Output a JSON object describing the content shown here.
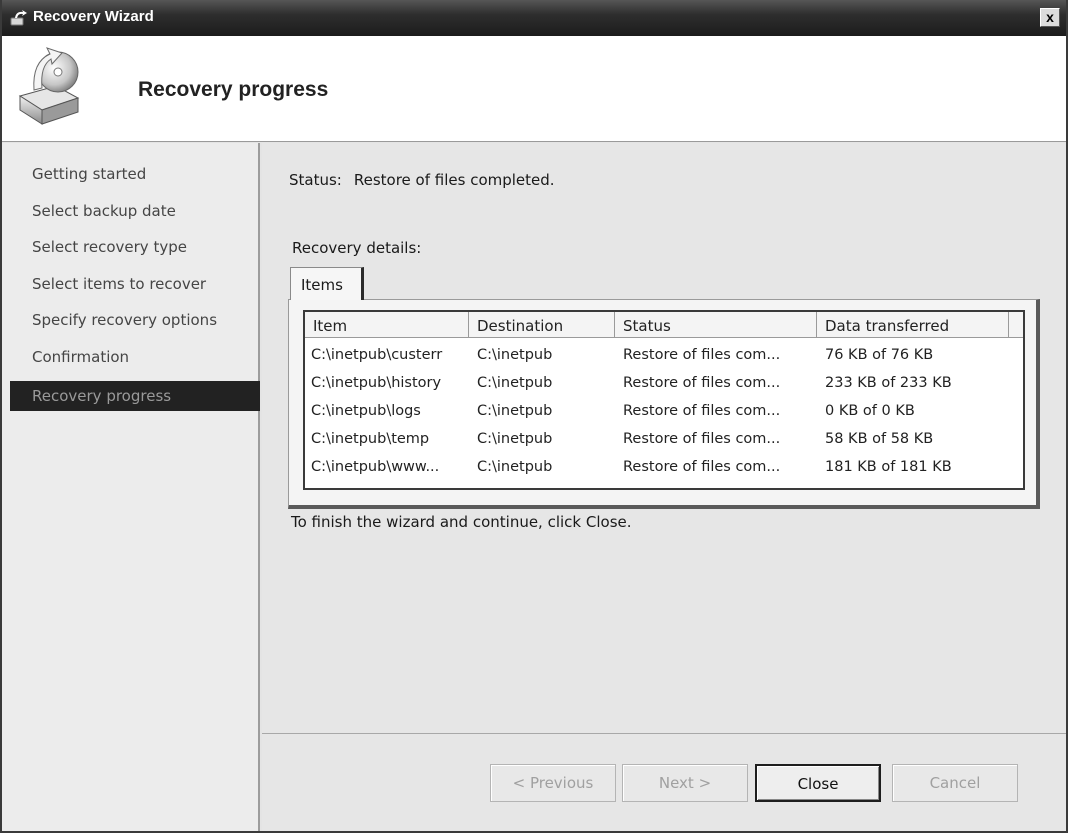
{
  "window": {
    "title": "Recovery Wizard",
    "close_glyph": "x",
    "header_title": "Recovery progress",
    "title_icon": "recovery-wizard-icon",
    "header_icon": "backup-drive-icon"
  },
  "nav": {
    "items": [
      {
        "label": "Getting started"
      },
      {
        "label": "Select backup date"
      },
      {
        "label": "Select recovery type"
      },
      {
        "label": "Select items to recover"
      },
      {
        "label": "Specify recovery options"
      },
      {
        "label": "Confirmation"
      },
      {
        "label": "Recovery progress"
      }
    ],
    "active_index": 6
  },
  "main": {
    "status_label": "Status:",
    "status_value": "Restore of files completed.",
    "details_label": "Recovery details:",
    "tab_label": "Items",
    "finish_text": "To finish the wizard and continue, click Close."
  },
  "table": {
    "columns": [
      "Item",
      "Destination",
      "Status",
      "Data transferred"
    ],
    "rows": [
      [
        "C:\\inetpub\\custerr",
        "C:\\inetpub",
        "Restore of files com...",
        "76 KB of 76 KB"
      ],
      [
        "C:\\inetpub\\history",
        "C:\\inetpub",
        "Restore of files com...",
        "233 KB of 233 KB"
      ],
      [
        "C:\\inetpub\\logs",
        "C:\\inetpub",
        "Restore of files com...",
        "0 KB of 0 KB"
      ],
      [
        "C:\\inetpub\\temp",
        "C:\\inetpub",
        "Restore of files com...",
        "58 KB of 58 KB"
      ],
      [
        "C:\\inetpub\\www...",
        "C:\\inetpub",
        "Restore of files com...",
        "181 KB of 181 KB"
      ]
    ]
  },
  "buttons": {
    "previous": "< Previous",
    "next": "Next >",
    "close": "Close",
    "cancel": "Cancel"
  },
  "colors": {
    "nav_active_bg": "#222222",
    "titlebar_bg": "#2e2e2e"
  }
}
